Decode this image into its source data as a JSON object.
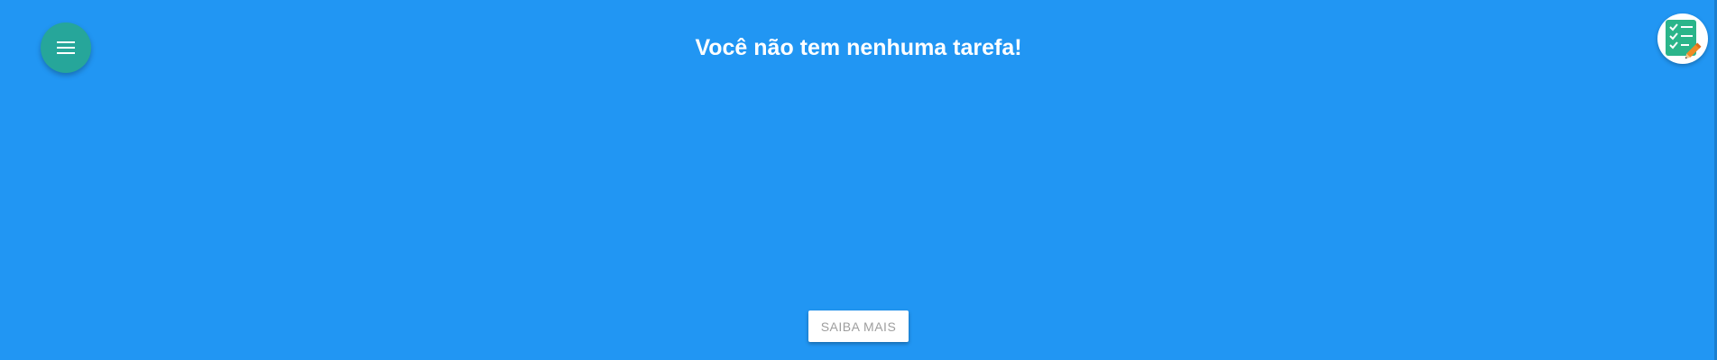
{
  "header": {
    "title": "Você não tem nenhuma tarefa!",
    "menu_icon": "hamburger-menu-icon",
    "logo_icon": "checklist-pencil-icon"
  },
  "main": {
    "learn_more_label": "SAIBA MAIS"
  },
  "colors": {
    "background": "#2196F3",
    "fab": "#26A69A",
    "logo_board": "#2BB58A",
    "pencil": "#F08A24",
    "button_text": "#9E9E9E"
  }
}
